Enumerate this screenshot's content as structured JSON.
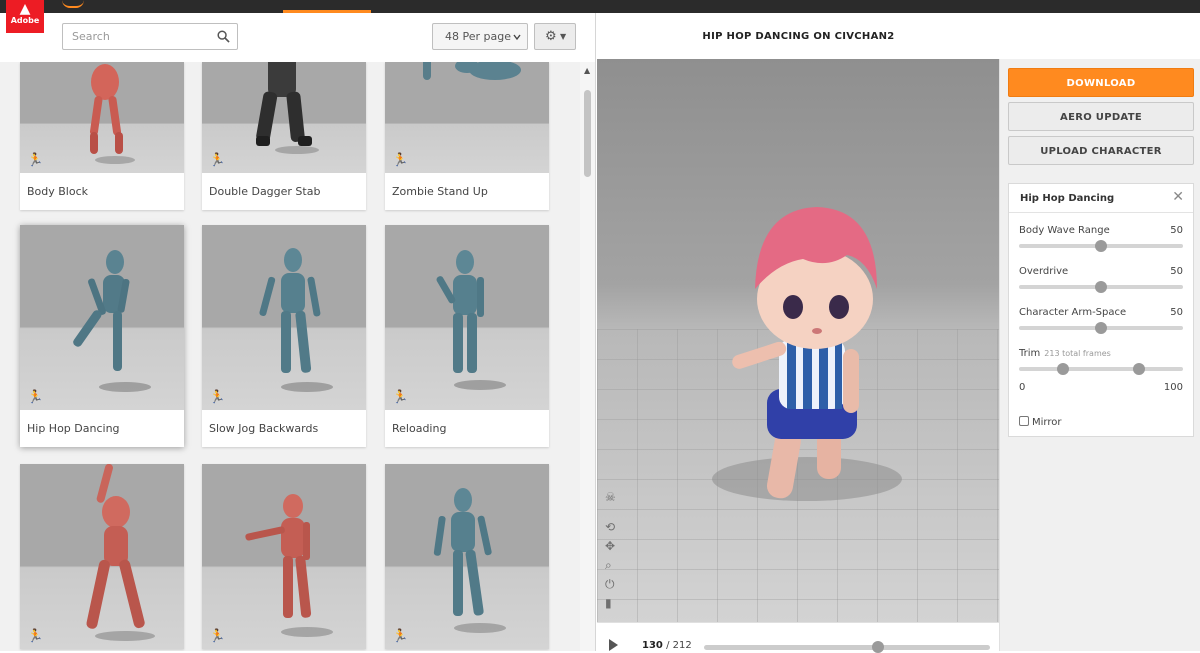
{
  "brand": {
    "logo_text": "Adobe"
  },
  "toolbar": {
    "search_placeholder": "Search",
    "per_page": "48 Per page"
  },
  "animations": [
    {
      "label": "Body Block"
    },
    {
      "label": "Double Dagger Stab"
    },
    {
      "label": "Zombie Stand Up"
    },
    {
      "label": "Hip Hop Dancing"
    },
    {
      "label": "Slow Jog Backwards"
    },
    {
      "label": "Reloading"
    }
  ],
  "viewer": {
    "title": "HIP HOP DANCING ON CIVCHAN2",
    "current_frame": "130",
    "total_frames": "/ 212",
    "progress_fraction": 0.61
  },
  "actions": {
    "download": "DOWNLOAD",
    "aero_update": "AERO UPDATE",
    "upload_character": "UPLOAD CHARACTER"
  },
  "params": {
    "title": "Hip Hop Dancing",
    "body_wave_label": "Body Wave Range",
    "body_wave_value": "50",
    "overdrive_label": "Overdrive",
    "overdrive_value": "50",
    "arm_space_label": "Character Arm-Space",
    "arm_space_value": "50",
    "trim_label": "Trim",
    "trim_note": "213 total frames",
    "trim_min": "0",
    "trim_max": "100",
    "mirror_label": "Mirror"
  },
  "colors": {
    "accent": "#ff8a1f",
    "adobe_red": "#ed1c24"
  }
}
